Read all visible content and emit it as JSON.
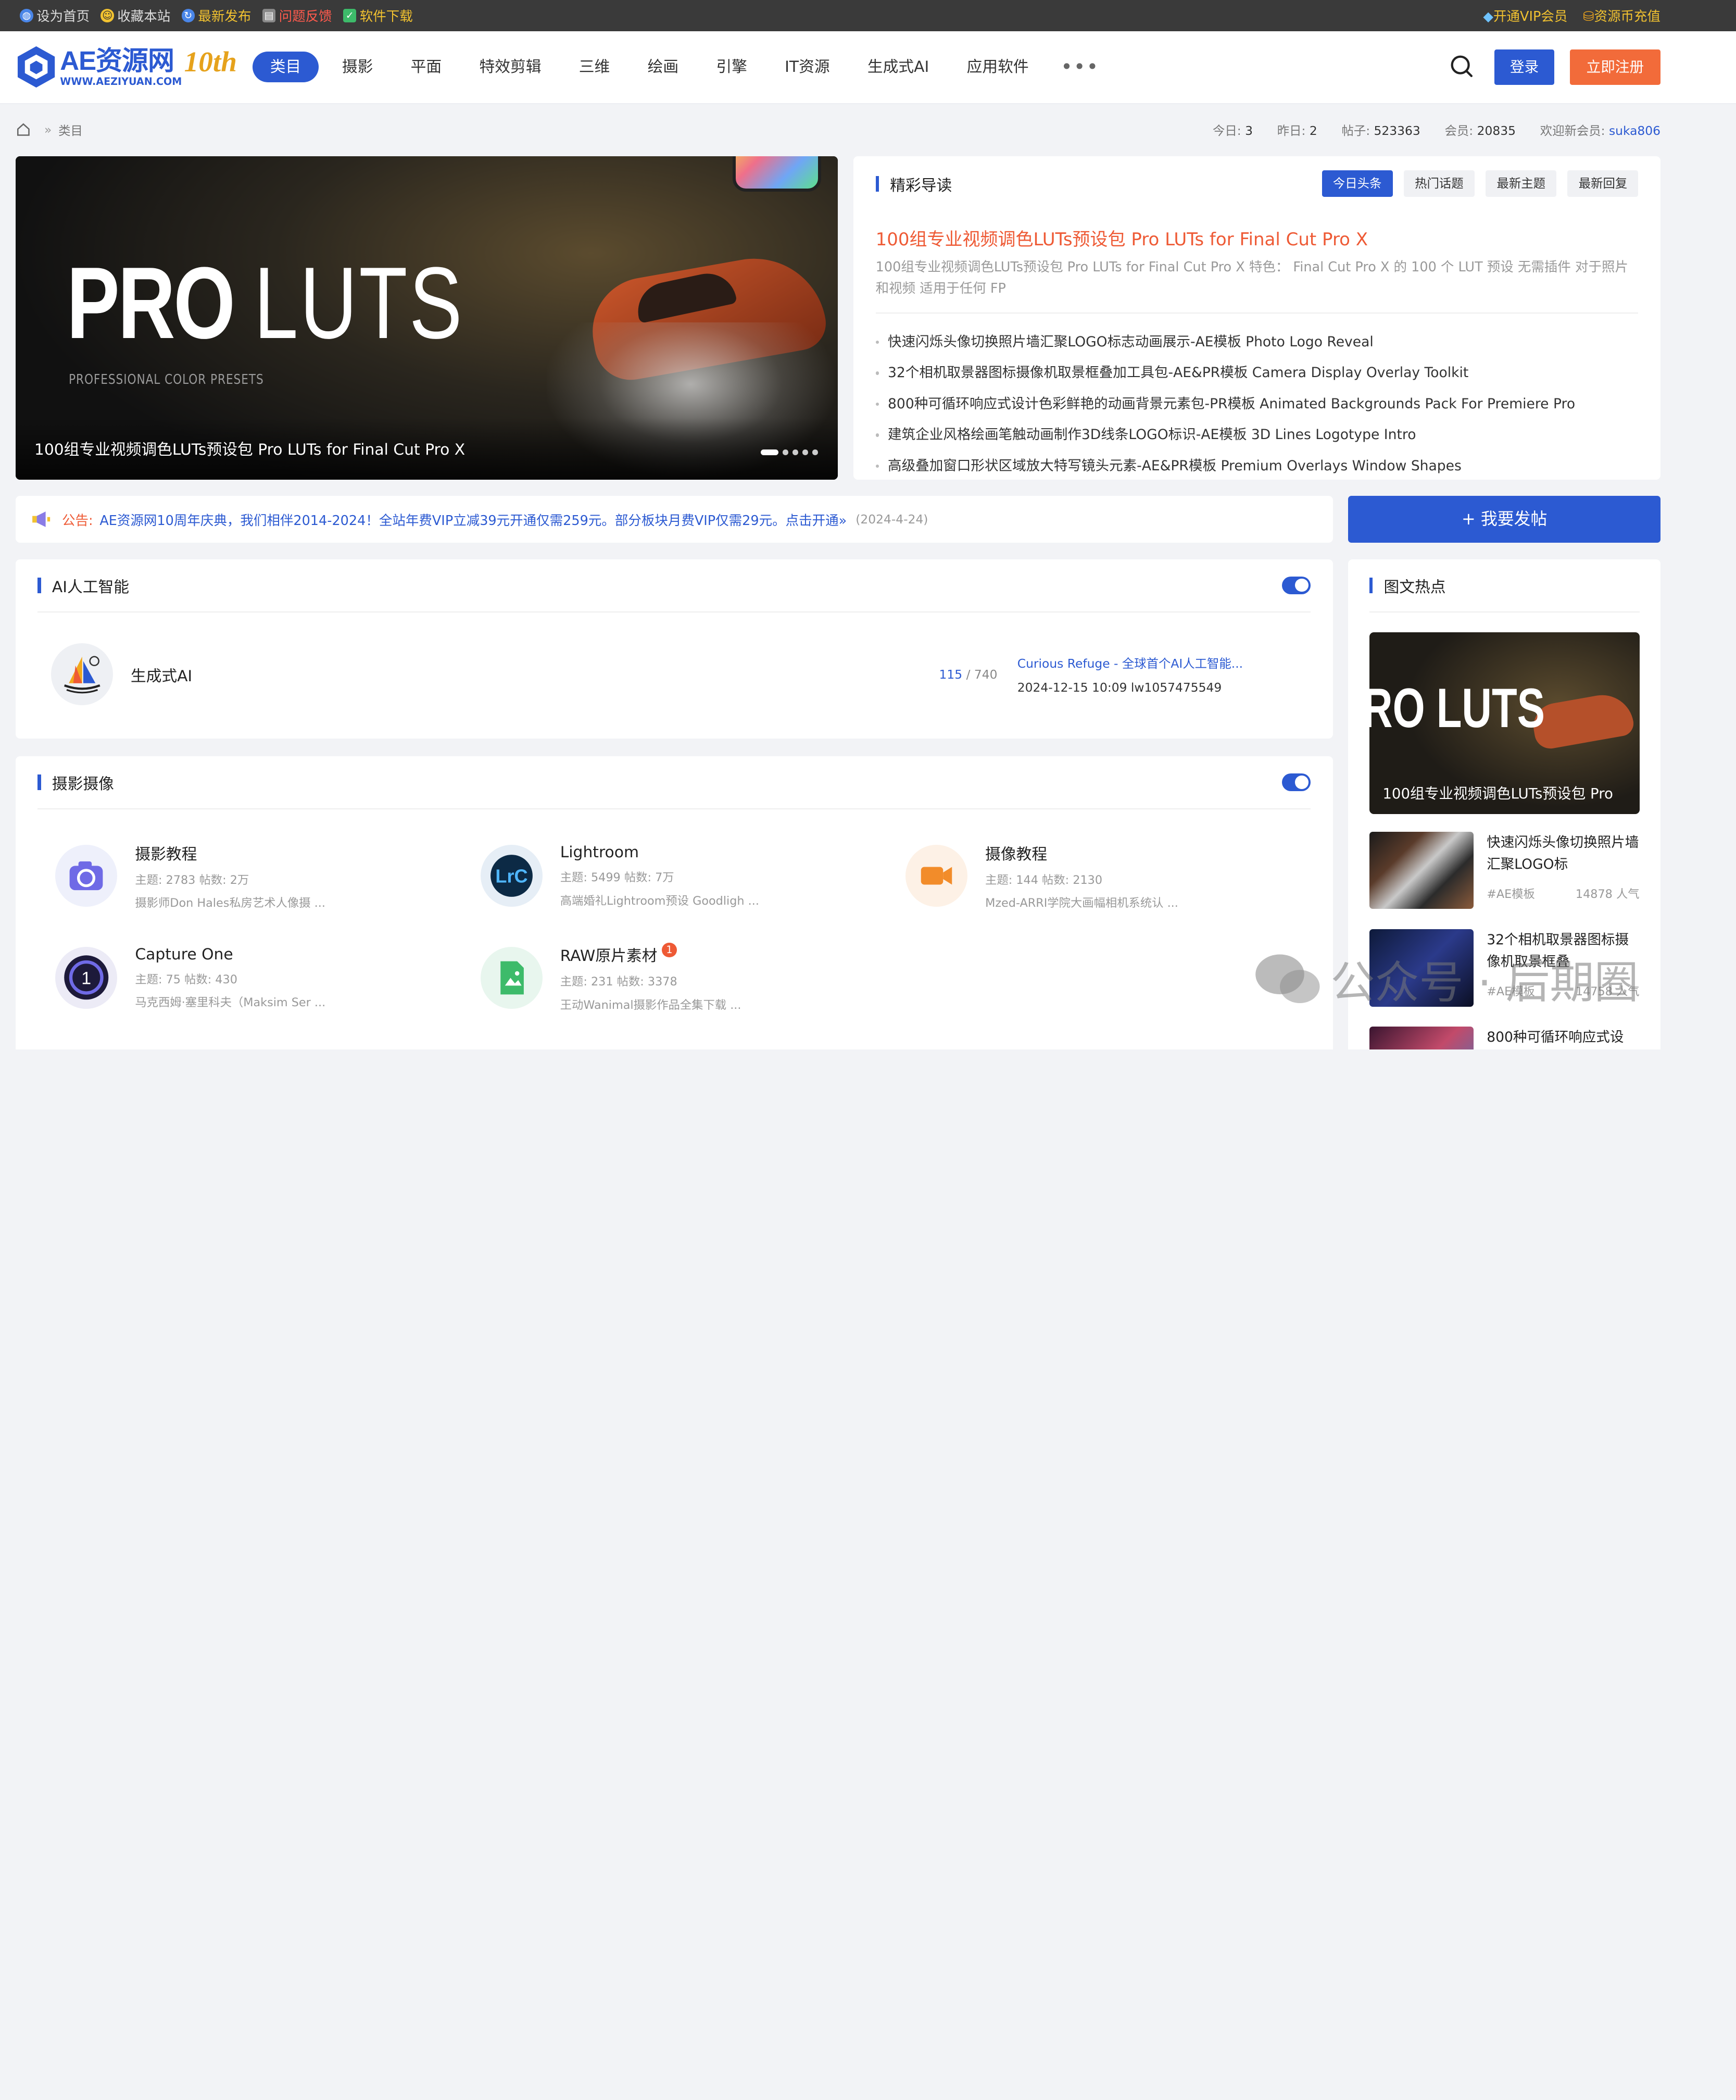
{
  "topbar": {
    "left": [
      {
        "label": "设为首页",
        "icon": "home-globe-icon"
      },
      {
        "label": "收藏本站",
        "icon": "smile-icon"
      },
      {
        "label": "最新发布",
        "icon": "refresh-icon"
      },
      {
        "label": "问题反馈",
        "icon": "feedback-icon"
      },
      {
        "label": "软件下载",
        "icon": "check-icon"
      }
    ],
    "right": [
      {
        "label": "开通VIP会员",
        "icon": "diamond-icon"
      },
      {
        "label": "资源币充值",
        "icon": "coin-icon"
      }
    ]
  },
  "header": {
    "logo_text": "AE资源网",
    "logo_url_text": "WWW.AEZIYUAN.COM",
    "logo_ten": "10th",
    "nav": [
      "类目",
      "摄影",
      "平面",
      "特效剪辑",
      "三维",
      "绘画",
      "引擎",
      "IT资源",
      "生成式AI",
      "应用软件"
    ],
    "more": "•••",
    "login": "登录",
    "register": "立即注册"
  },
  "breadcrumb": {
    "sep": "»",
    "current": "类目"
  },
  "stats": {
    "today_label": "今日:",
    "today": "3",
    "yesterday_label": "昨日:",
    "yesterday": "2",
    "posts_label": "帖子:",
    "posts": "523363",
    "members_label": "会员:",
    "members": "20835",
    "welcome_label": "欢迎新会员:",
    "newest": "suka806"
  },
  "slider": {
    "big_text_a": "PRO",
    "big_text_b": "LUTS",
    "sub": "PROFESSIONAL COLOR PRESETS",
    "caption": "100组专业视频调色LUTs预设包 Pro LUTs for Final Cut Pro X",
    "slide_index": 1,
    "slide_count": 5
  },
  "guide": {
    "title": "精彩导读",
    "tabs": [
      "今日头条",
      "热门话题",
      "最新主题",
      "最新回复"
    ],
    "headline": "100组专业视频调色LUTs预设包 Pro LUTs for Final Cut Pro X",
    "headline_desc": "100组专业视频调色LUTs预设包 Pro LUTs for Final Cut Pro X 特色： Final Cut Pro X 的 100 个 LUT 预设 无需插件 对于照片和视频 适用于任何 FP",
    "items": [
      "快速闪烁头像切换照片墙汇聚LOGO标志动画展示-AE模板 Photo Logo Reveal",
      "32个相机取景器图标摄像机取景框叠加工具包-AE&PR模板 Camera Display Overlay Toolkit",
      "800种可循环响应式设计色彩鲜艳的动画背景元素包-PR模板 Animated Backgrounds Pack For Premiere Pro",
      "建筑企业风格绘画笔触动画制作3D线条LOGO标识-AE模板 3D Lines Logotype Intro",
      "高级叠加窗口形状区域放大特写镜头元素-AE&PR模板 Premium Overlays Window Shapes"
    ]
  },
  "notice": {
    "label": "公告:",
    "text": "AE资源网10周年庆典，我们相伴2014-2024！全站年费VIP立减39元开通仅需259元。部分板块月费VIP仅需29元。点击开通»",
    "date": "(2024-4-24)"
  },
  "post_button": "+ 我要发帖",
  "ai_section": {
    "title": "AI人工智能",
    "forum": {
      "name": "生成式AI",
      "count_a": "115",
      "count_sep": "/",
      "count_b": "740",
      "last_title": "Curious Refuge - 全球首个AI人工智能...",
      "last_meta": "2024-12-15 10:09 lw1057475549"
    }
  },
  "photo_section": {
    "title": "摄影摄像",
    "forums": [
      {
        "name": "摄影教程",
        "stats": "主题: 2783    帖数: 2万",
        "desc": "摄影师Don Hales私房艺术人像摄 ...",
        "badge": "",
        "icon": "camera-icon",
        "color": "#6f6ae6"
      },
      {
        "name": "Lightroom",
        "stats": "主题: 5499    帖数: 7万",
        "desc": "高端婚礼Lightroom预设 Goodligh ...",
        "badge": "",
        "icon": "lightroom-icon",
        "color": "#0c2a45"
      },
      {
        "name": "摄像教程",
        "stats": "主题: 144    帖数: 2130",
        "desc": "Mzed-ARRI学院大画幅相机系统认 ...",
        "badge": "",
        "icon": "video-camera-icon",
        "color": "#f28c2a"
      },
      {
        "name": "Capture One",
        "stats": "主题: 75    帖数: 430",
        "desc": "马克西姆·塞里科夫（Maksim Ser ...",
        "badge": "",
        "icon": "capture-one-icon",
        "color": "#1d1a3a"
      },
      {
        "name": "RAW原片素材",
        "stats": "主题: 231    帖数: 3378",
        "desc": "王动Wanimal摄影作品全集下载 ...",
        "badge": "1",
        "icon": "raw-image-icon",
        "color": "#3dbb6a"
      }
    ]
  },
  "hot": {
    "title": "图文热点",
    "cover_text": "RO LUTS",
    "cover_caption": "100组专业视频调色LUTs预设包 Pro",
    "items": [
      {
        "title": "快速闪烁头像切换照片墙汇聚LOGO标",
        "tag": "#AE模板",
        "views": "14878 人气"
      },
      {
        "title": "32个相机取景器图标摄像机取景框叠",
        "tag": "#AE模板",
        "views": "14758 人气"
      },
      {
        "title": "800种可循环响应式设",
        "tag": "",
        "views": ""
      }
    ]
  },
  "watermark": "公众号 · 后期圈"
}
